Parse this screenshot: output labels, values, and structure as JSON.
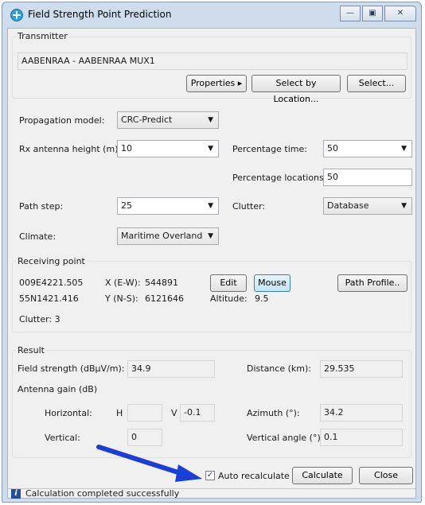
{
  "window": {
    "title": "Field Strength Point Prediction",
    "controls": [
      "—",
      "▣",
      "✕"
    ]
  },
  "transmitter": {
    "group_label": "Transmitter",
    "name": "AABENRAA - AABENRAA MUX1",
    "properties_button": "Properties ▸",
    "select_by_location_button": "Select by Location...",
    "select_button": "Select..."
  },
  "settings": {
    "propagation_model_label": "Propagation model:",
    "propagation_model_value": "CRC-Predict",
    "rx_height_label": "Rx antenna height (m):",
    "rx_height_value": "10",
    "percentage_time_label": "Percentage time:",
    "percentage_time_value": "50",
    "percentage_locations_label": "Percentage locations:",
    "percentage_locations_value": "50",
    "path_step_label": "Path step:",
    "path_step_value": "25",
    "clutter_label": "Clutter:",
    "clutter_value": "Database",
    "climate_label": "Climate:",
    "climate_value": "Maritime Overland"
  },
  "receiving_point": {
    "group_label": "Receiving point",
    "lon": "009E4221.505",
    "lat": "55N1421.416",
    "x_label": "X (E-W):",
    "x_value": "544891",
    "y_label": "Y (N-S):",
    "y_value": "6121646",
    "edit_button": "Edit",
    "mouse_button": "Mouse",
    "path_profile_button": "Path Profile..",
    "altitude_label": "Altitude:",
    "altitude_value": "9.5",
    "clutter_text": "Clutter:  3"
  },
  "result": {
    "group_label": "Result",
    "field_strength_label": "Field strength (dBµV/m):",
    "field_strength_value": "34.9",
    "distance_label": "Distance (km):",
    "distance_value": "29.535",
    "antenna_gain_label": "Antenna gain (dB)",
    "horizontal_label": "Horizontal:",
    "h_label": "H",
    "h_value": "",
    "v_label": "V",
    "v_value": "-0.1",
    "azimuth_label": "Azimuth (°):",
    "azimuth_value": "34.2",
    "vertical_label": "Vertical:",
    "vertical_value": "0",
    "vertical_angle_label": "Vertical angle (°):",
    "vertical_angle_value": "0.1"
  },
  "footer": {
    "auto_recalculate_label": "Auto recalculate",
    "auto_recalculate_checked": true,
    "calculate_button": "Calculate",
    "close_button": "Close"
  },
  "status": {
    "text": "Calculation completed successfully"
  },
  "colors": {
    "arrow": "#1a3fd6",
    "status_icon": "#1f4f9e"
  }
}
